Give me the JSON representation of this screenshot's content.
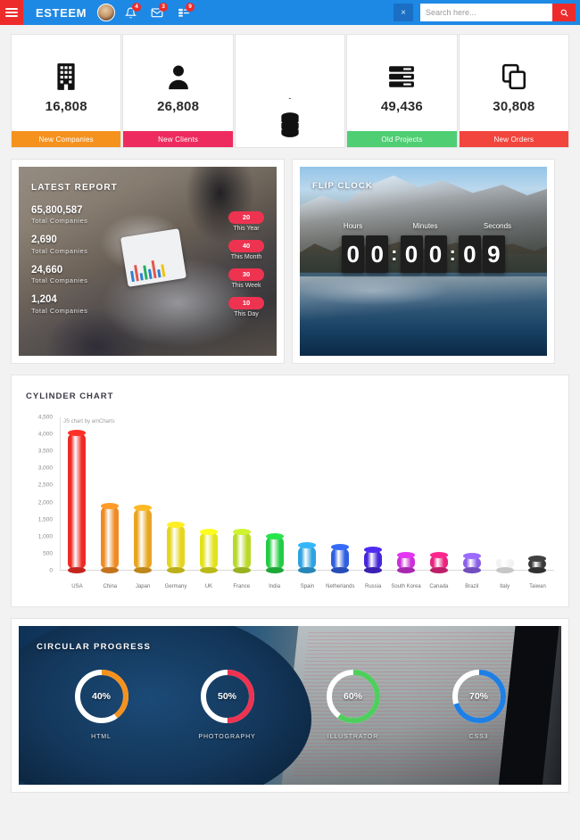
{
  "navbar": {
    "brand": "ESTEEM",
    "menu_icon": "hamburger-icon",
    "avatar": "user-avatar",
    "notifications": {
      "icon": "bell-icon",
      "badge": "4"
    },
    "messages": {
      "icon": "envelope-icon",
      "badge": "3"
    },
    "tasks": {
      "icon": "tasks-icon",
      "badge": "9"
    },
    "close_label": "×",
    "search": {
      "placeholder": "Search here...",
      "value": "",
      "button_icon": "search-icon"
    },
    "accent_blue": "#1e88e5",
    "accent_red": "#ee2b2b"
  },
  "stats": [
    {
      "icon": "building-icon",
      "value": "16,808",
      "label": "New Companies",
      "color": "#f5921e"
    },
    {
      "icon": "user-icon",
      "value": "26,808",
      "label": "New Clients",
      "color": "#ee2b5e"
    },
    {
      "icon": "database-icon",
      "value": "-",
      "label": "",
      "color": "#ffffff",
      "animating": true
    },
    {
      "icon": "server-icon",
      "value": "49,436",
      "label": "Old Projects",
      "color": "#4fce73"
    },
    {
      "icon": "copy-icon",
      "value": "30,808",
      "label": "New Orders",
      "color": "#f2453d"
    }
  ],
  "latest_report": {
    "title": "LATEST REPORT",
    "items": [
      {
        "value": "65,800,587",
        "label": "Total Companies"
      },
      {
        "value": "2,690",
        "label": "Total Companies"
      },
      {
        "value": "24,660",
        "label": "Total Companies"
      },
      {
        "value": "1,204",
        "label": "Total Companies"
      }
    ],
    "badges": [
      {
        "value": "20",
        "label": "This Year"
      },
      {
        "value": "40",
        "label": "This Month"
      },
      {
        "value": "30",
        "label": "This Week"
      },
      {
        "value": "10",
        "label": "This Day"
      }
    ],
    "badge_color": "#ee3350"
  },
  "flip_clock": {
    "title": "FLIP CLOCK",
    "labels": {
      "hours": "Hours",
      "minutes": "Minutes",
      "seconds": "Seconds"
    },
    "hours": "00",
    "minutes": "00",
    "seconds": "09",
    "separator": ":"
  },
  "cylinder_chart": {
    "title": "CYLINDER CHART"
  },
  "chart_data": {
    "type": "bar",
    "title": "CYLINDER CHART",
    "annotation": "JS chart by amCharts",
    "xlabel": "",
    "ylabel": "",
    "ylim": [
      0,
      4500
    ],
    "yticks": [
      "0",
      "500",
      "1,000",
      "1,500",
      "2,000",
      "2,500",
      "3,000",
      "3,500",
      "4,000",
      "4,500"
    ],
    "grid": false,
    "legend": "none",
    "categories": [
      "USA",
      "China",
      "Japan",
      "Germany",
      "UK",
      "France",
      "India",
      "Spain",
      "Netherlands",
      "Russia",
      "South Korea",
      "Canada",
      "Brazil",
      "Italy",
      "Taiwan"
    ],
    "values": [
      4025,
      1882,
      1809,
      1322,
      1122,
      1114,
      984,
      711,
      665,
      580,
      443,
      441,
      395,
      386,
      338
    ],
    "colors": [
      "#ef2b25",
      "#f08b24",
      "#e8a521",
      "#e6d51f",
      "#e2e21c",
      "#b9d929",
      "#22cc44",
      "#2ea3df",
      "#2f5fe0",
      "#4726d8",
      "#cc2fd8",
      "#e8237e",
      "#8a5fe8",
      "#f2f2f2",
      "#3a3a3a"
    ]
  },
  "circular_progress": {
    "title": "CIRCULAR PROGRESS",
    "items": [
      {
        "percent": 40,
        "value": "40%",
        "label": "HTML",
        "color": "#f5921e"
      },
      {
        "percent": 50,
        "value": "50%",
        "label": "PHOTOGRAPHY",
        "color": "#ee3350"
      },
      {
        "percent": 60,
        "value": "60%",
        "label": "ILLUSTRATOR",
        "color": "#4fce5e"
      },
      {
        "percent": 70,
        "value": "70%",
        "label": "CSS3",
        "color": "#1e7fe5"
      }
    ],
    "track_color": "#ffffff"
  }
}
